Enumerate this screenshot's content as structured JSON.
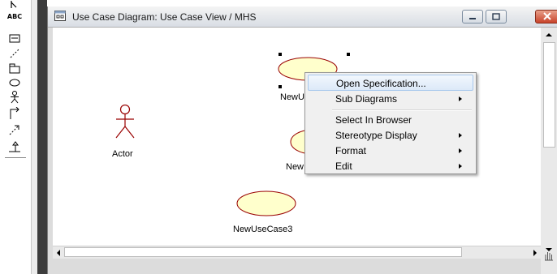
{
  "toolbox": {
    "text_tool": "ABC",
    "tools": [
      "selector-icon",
      "text-icon",
      "note-icon",
      "anchor-note-icon",
      "package-icon",
      "use-case-icon",
      "actor-icon",
      "association-icon",
      "dependency-icon",
      "generalization-icon"
    ]
  },
  "window": {
    "title": "Use Case Diagram: Use Case View / MHS",
    "buttons": [
      "minimize",
      "maximize",
      "close"
    ]
  },
  "diagram": {
    "actor_label": "Actor",
    "usecase_labels": [
      "NewU",
      "New",
      "NewUseCase3"
    ],
    "usecase_fill": "#ffffcc",
    "stroke_color": "#990000"
  },
  "context_menu": {
    "items": [
      {
        "label": "Open Specification...",
        "submenu": false,
        "highlighted": true
      },
      {
        "label": "Sub Diagrams",
        "submenu": true
      },
      {
        "label": "Select In Browser",
        "submenu": false
      },
      {
        "label": "Stereotype Display",
        "submenu": true
      },
      {
        "label": "Format",
        "submenu": true
      },
      {
        "label": "Edit",
        "submenu": true
      }
    ]
  }
}
